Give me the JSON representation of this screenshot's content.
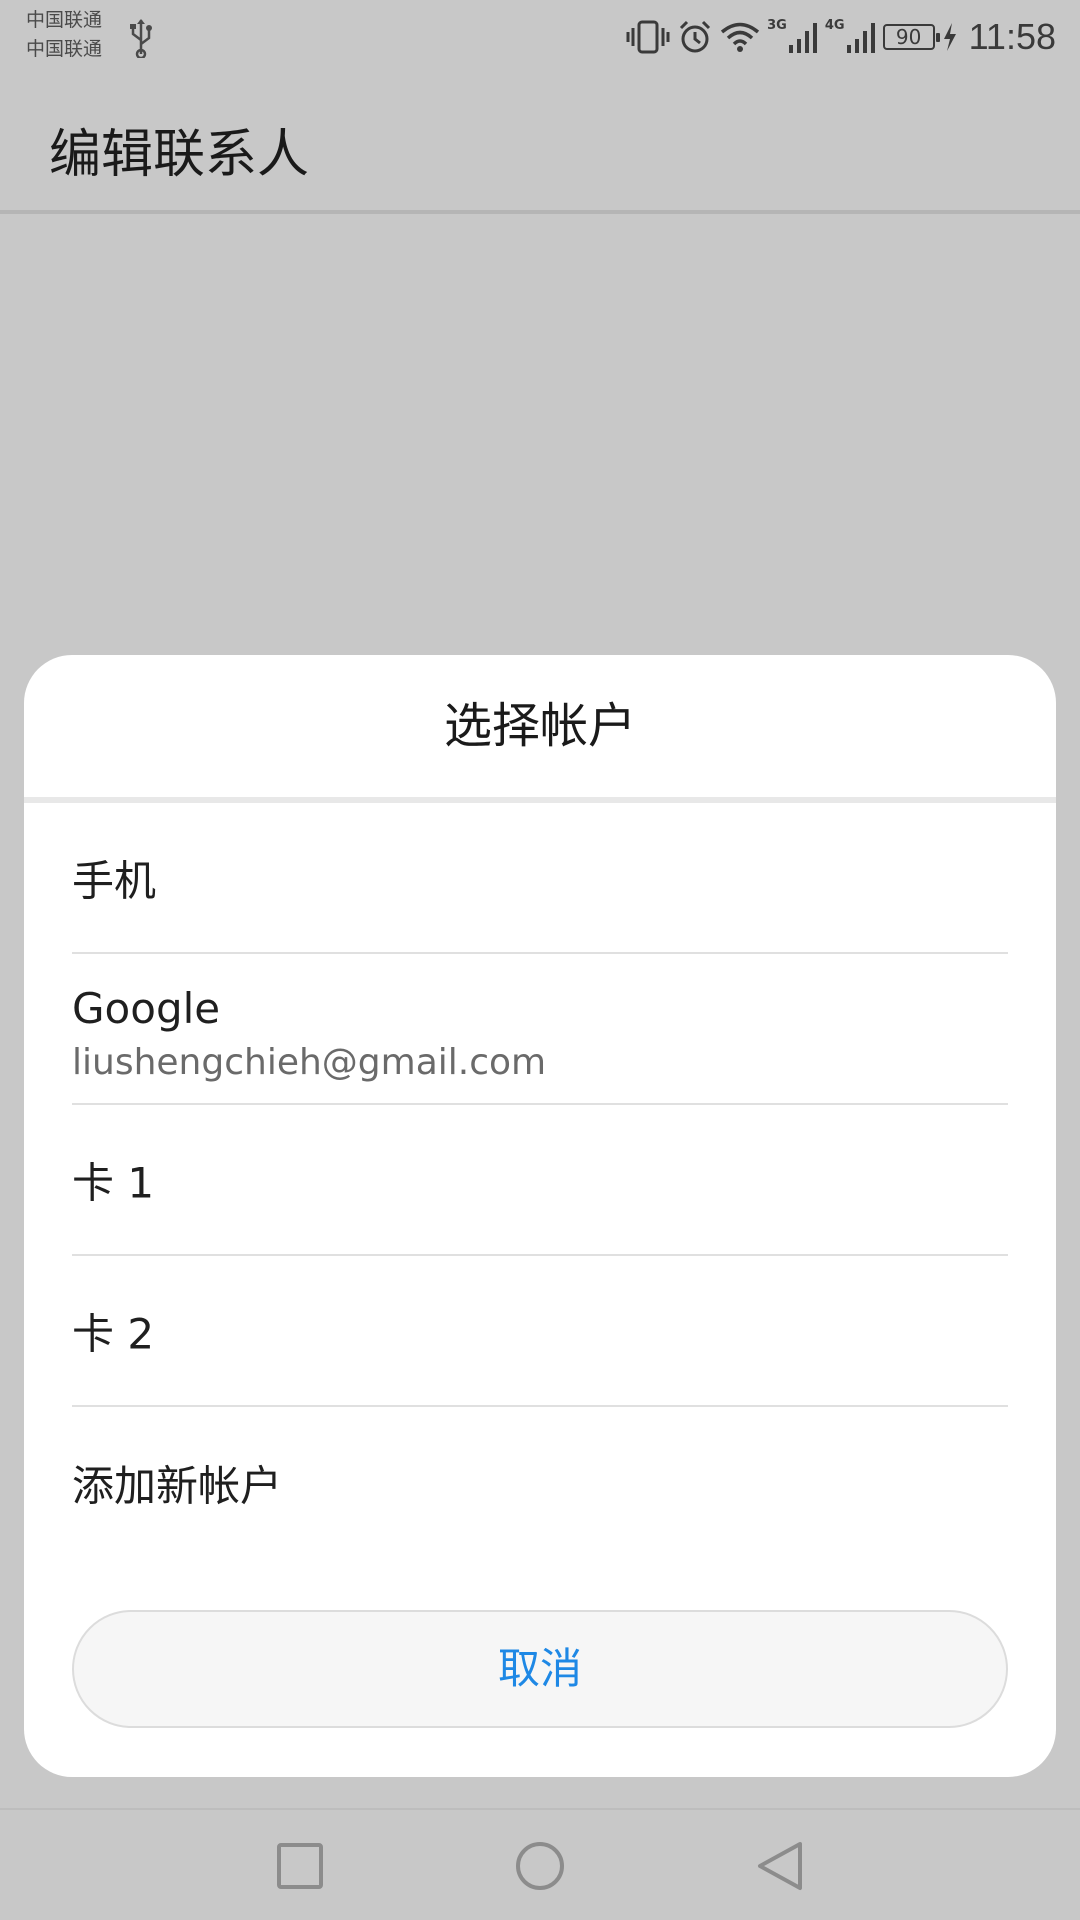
{
  "status_bar": {
    "carrier_1": "中国联通",
    "carrier_2": "中国联通",
    "network_1": "3G",
    "network_2": "4G",
    "battery": "90",
    "time": "11:58",
    "icons": [
      "usb-icon",
      "vibrate-icon",
      "alarm-icon",
      "wifi-icon",
      "signal-icon",
      "signal-icon",
      "battery-icon",
      "charging-icon"
    ]
  },
  "app_bar": {
    "title": "编辑联系人"
  },
  "dialog": {
    "title": "选择帐户",
    "items": [
      {
        "label": "手机"
      },
      {
        "label": "Google",
        "sub": "liushengchieh@gmail.com"
      },
      {
        "label": "卡 1"
      },
      {
        "label": "卡 2"
      },
      {
        "label": "添加新帐户"
      }
    ],
    "cancel_label": "取消"
  },
  "nav_bar": {
    "icons": [
      "recent-apps-icon",
      "home-icon",
      "back-icon"
    ]
  },
  "colors": {
    "accent": "#1e88e5",
    "scrim": "#c8c8c8",
    "dialog_bg": "#ffffff"
  }
}
